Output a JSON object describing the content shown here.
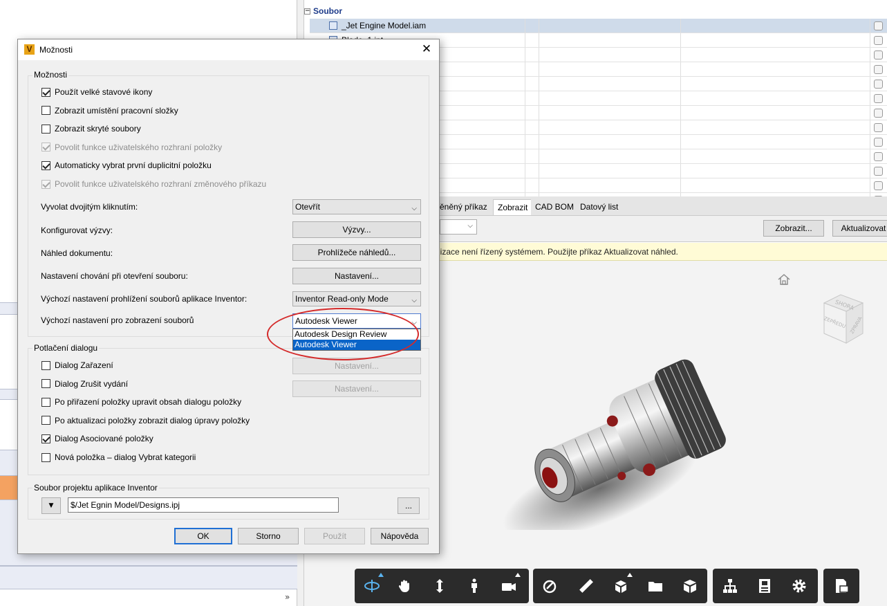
{
  "background": {
    "file_table": {
      "group_label": "Soubor",
      "rows": [
        "_Jet Engine Model.iam",
        "Blade_1.ipt",
        "",
        "",
        "",
        "",
        "",
        "",
        "",
        "",
        "",
        "",
        ""
      ]
    },
    "tabs": [
      "ěněný příkaz",
      "Zobrazit",
      "CAD BOM",
      "Datový list"
    ],
    "active_tab_index": 1,
    "buttons": {
      "zobrazit": "Zobrazit...",
      "aktualizovat": "Aktualizovat"
    },
    "info_text": "lizace není řízený systémem. Použijte příkaz Aktualizovat náhled.",
    "viewcube": {
      "top": "SHORA",
      "front": "ZEPŘEDU",
      "right": "ZPRAVA"
    },
    "left_scroll_glyph": "»"
  },
  "viewer_toolbar": {
    "icons": [
      "orbit-icon",
      "pan-hand-icon",
      "zoom-icon",
      "first-person-icon",
      "camera-icon",
      "measure-tape-icon",
      "ruler-icon",
      "explode-icon",
      "folder-icon",
      "box-icon",
      "structure-tree-icon",
      "properties-icon",
      "settings-gear-icon",
      "export-icon"
    ]
  },
  "dialog": {
    "title": "Možnosti",
    "options_group": {
      "label": "Možnosti",
      "checkboxes": [
        {
          "label": "Použít velké stavové ikony",
          "checked": true,
          "disabled": false
        },
        {
          "label": "Zobrazit umístění pracovní složky",
          "checked": false,
          "disabled": false
        },
        {
          "label": "Zobrazit skryté soubory",
          "checked": false,
          "disabled": false
        },
        {
          "label": "Povolit funkce uživatelského rozhraní položky",
          "checked": true,
          "disabled": true
        },
        {
          "label": "Automaticky vybrat první duplicitní položku",
          "checked": true,
          "disabled": false
        },
        {
          "label": "Povolit funkce uživatelského rozhraní změnového příkazu",
          "checked": true,
          "disabled": true
        }
      ],
      "double_click": {
        "label": "Vyvolat dvojitým kliknutím:",
        "value": "Otevřít"
      },
      "prompts": {
        "label": "Konfigurovat výzvy:",
        "button": "Výzvy..."
      },
      "preview": {
        "label": "Náhled dokumentu:",
        "button": "Prohlížeče náhledů..."
      },
      "open_behavior": {
        "label": "Nastavení chování při otevření souboru:",
        "button": "Nastavení..."
      },
      "inventor_viewer": {
        "label": "Výchozí nastavení prohlížení souborů aplikace Inventor:",
        "value": "Inventor Read-only Mode"
      },
      "file_display": {
        "label": "Výchozí nastavení pro zobrazení souborů",
        "value": "Autodesk Viewer",
        "options": [
          "Autodesk Design Review",
          "Autodesk Viewer"
        ],
        "selected_index": 1
      }
    },
    "suppress_group": {
      "label": "Potlačení dialogu",
      "checkboxes": [
        {
          "label": "Dialog Zařazení",
          "checked": false
        },
        {
          "label": "Dialog Zrušit vydání",
          "checked": false
        },
        {
          "label": "Po přiřazení položky upravit obsah dialogu položky",
          "checked": false
        },
        {
          "label": "Po aktualizaci položky zobrazit dialog úpravy položky",
          "checked": false
        },
        {
          "label": "Dialog Asociované položky",
          "checked": true
        },
        {
          "label": "Nová položka – dialog Vybrat kategorii",
          "checked": false
        }
      ],
      "settings_buttons": [
        "Nastavení...",
        "Nastavení..."
      ]
    },
    "project_group": {
      "label": "Soubor projektu aplikace Inventor",
      "path": "$/Jet Egnin Model/Designs.ipj",
      "browse": "...",
      "drop": "▼"
    },
    "buttons": {
      "ok": "OK",
      "cancel": "Storno",
      "apply": "Použít",
      "help": "Nápověda"
    },
    "close_glyph": "✕",
    "logo_letter": "V",
    "chevron": "⌵"
  }
}
